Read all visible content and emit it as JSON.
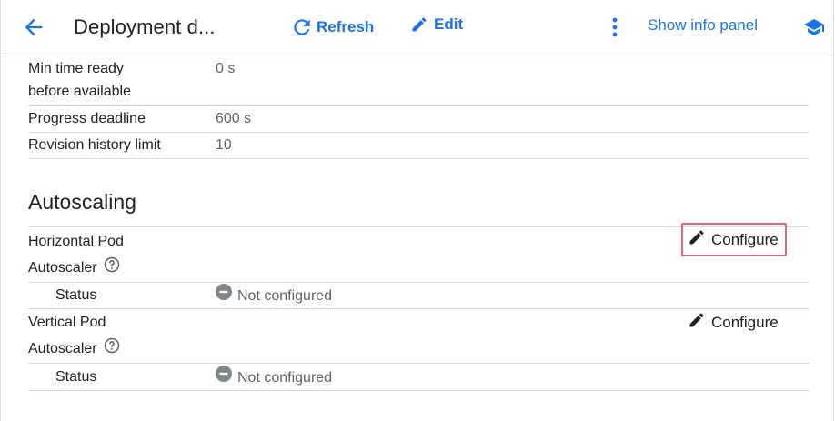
{
  "header": {
    "title": "Deployment d...",
    "refresh_label": "Refresh",
    "edit_label": "Edit",
    "info_panel_label": "Show info panel"
  },
  "details": [
    {
      "label_line1": "Min time ready",
      "label_line2": "before available",
      "value": "0 s"
    },
    {
      "label": "Progress deadline",
      "value": "600 s"
    },
    {
      "label": "Revision history limit",
      "value": "10"
    }
  ],
  "autoscaling": {
    "title": "Autoscaling",
    "hpa": {
      "label_line1": "Horizontal Pod",
      "label_line2": "Autoscaler",
      "configure_label": "Configure",
      "status_label": "Status",
      "status_value": "Not configured"
    },
    "vpa": {
      "label_line1": "Vertical Pod",
      "label_line2": "Autoscaler",
      "configure_label": "Configure",
      "status_label": "Status",
      "status_value": "Not configured"
    }
  },
  "colors": {
    "accent": "#1a73e8",
    "highlight_border": "#e8637d",
    "status_icon": "#80868b"
  }
}
